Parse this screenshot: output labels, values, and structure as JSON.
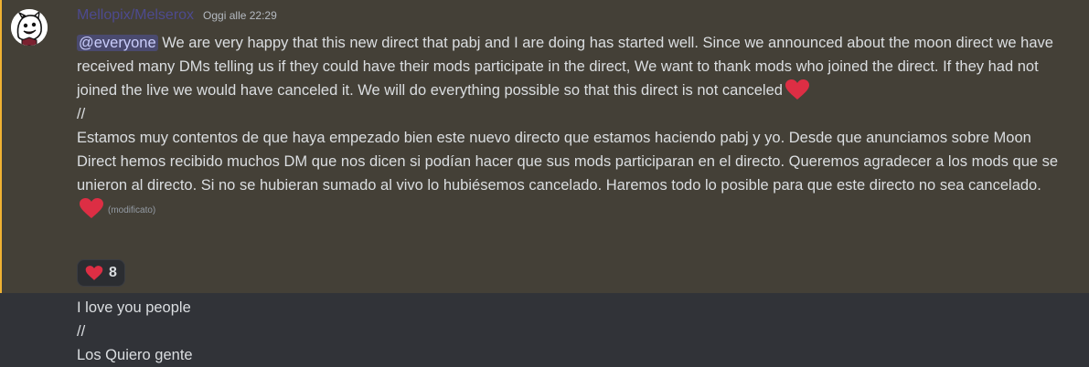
{
  "message1": {
    "author": "Mellopix/Melserox",
    "timestamp": "Oggi alle 22:29",
    "mention": "@everyone",
    "english_text": " We are very happy that this new direct that pabj and I are doing has started well. Since we announced about the moon direct we have received many DMs telling us if they could have their mods participate in the direct, We want to thank mods who joined the direct. If they had not joined the live we would have canceled it. We will do everything possible so that this direct is not canceled",
    "separator": "//",
    "spanish_text": "Estamos muy contentos de que haya empezado bien este nuevo directo que estamos haciendo pabj y yo. Desde que anunciamos sobre Moon Direct  hemos recibido muchos DM que nos dicen si podían hacer que sus mods participaran en el directo. Queremos agradecer a los mods que se unieron al directo. Si no se hubieran sumado al vivo lo hubiésemos cancelado. Haremos todo lo posible para que este directo no sea cancelado.",
    "edited_label": "(modificato)",
    "emoji": "heart-emoji",
    "reaction": {
      "emoji": "heart-emoji",
      "count": "8"
    },
    "highlight_color": "#444037"
  },
  "message2": {
    "line1": "I love you people",
    "line2": "//",
    "line3": "Los Quiero gente"
  }
}
